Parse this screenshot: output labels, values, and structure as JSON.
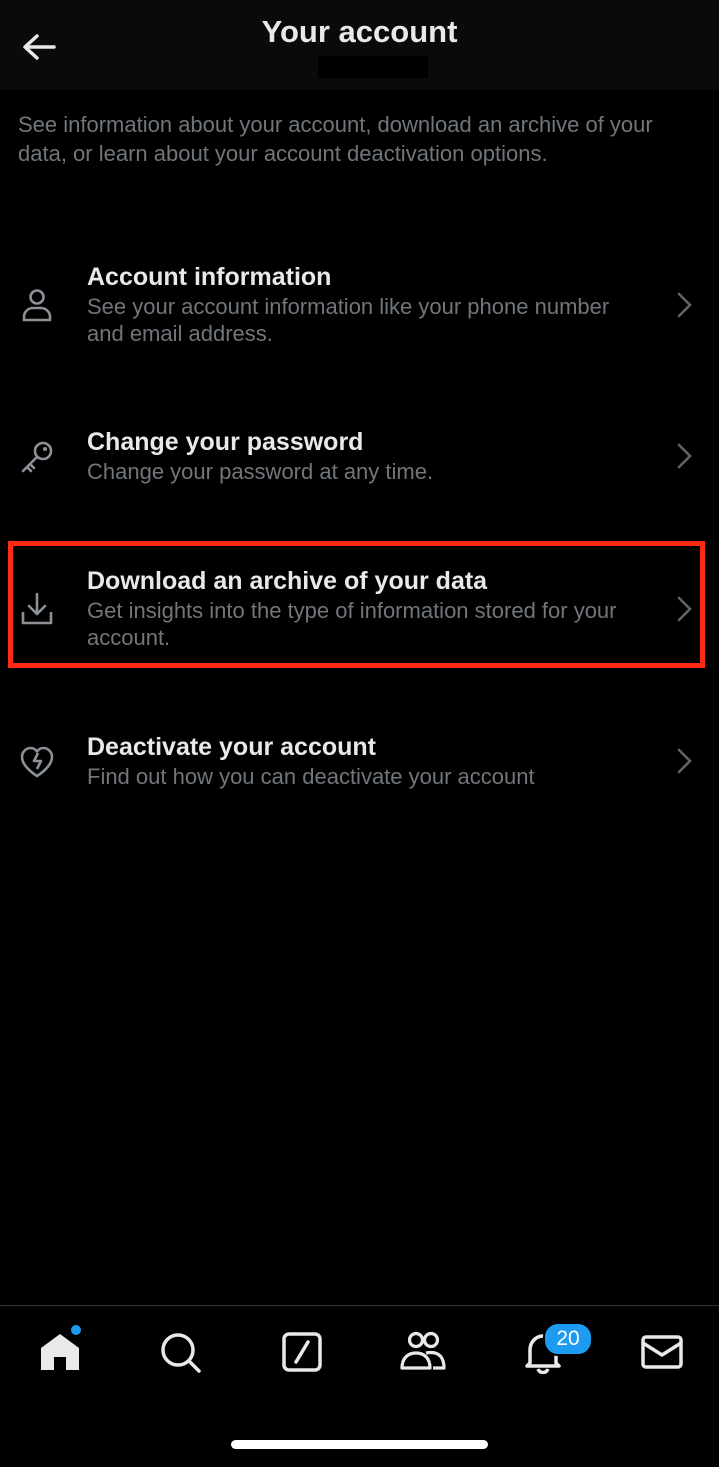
{
  "header": {
    "title": "Your account",
    "handle_prefix": "@"
  },
  "intro": "See information about your account, download an archive of your data, or learn about your account deactivation options.",
  "items": [
    {
      "title": "Account information",
      "description": "See your account information like your phone number and email address.",
      "icon": "person-icon"
    },
    {
      "title": "Change your password",
      "description": "Change your password at any time.",
      "icon": "key-icon"
    },
    {
      "title": "Download an archive of your data",
      "description": "Get insights into the type of information stored for your account.",
      "icon": "download-icon",
      "highlighted": true
    },
    {
      "title": "Deactivate your account",
      "description": "Find out how you can deactivate your account",
      "icon": "broken-heart-icon"
    }
  ],
  "tabbar": {
    "notifications_badge": "20",
    "tabs": [
      "home-icon",
      "search-icon",
      "grok-icon",
      "communities-icon",
      "notifications-icon",
      "messages-icon"
    ]
  },
  "colors": {
    "background": "#000000",
    "primary_text": "#e7e9ea",
    "secondary_text": "#71767b",
    "accent": "#1d9bf0",
    "highlight_border": "#ff2a12"
  }
}
